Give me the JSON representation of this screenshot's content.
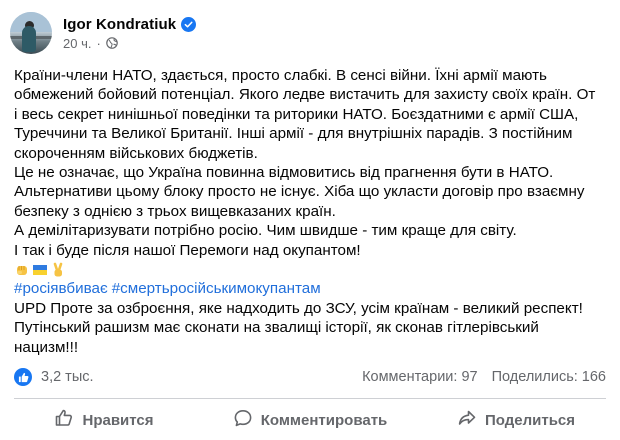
{
  "author": {
    "name": "Igor Kondratiuk",
    "time": "20 ч.",
    "separator": "·",
    "verified_icon": "verified-badge-icon",
    "audience_icon": "globe-icon"
  },
  "post": {
    "lines": [
      "Країни-члени НАТО, здається,  просто слабкі. В сенсі війни. Їхні армії мають",
      "обмежений бойовий потенціал. Якого ледве вистачить для захисту своїх країн. От",
      "і весь секрет нинішньої поведінки та риторики НАТО.  Боєздатними є армії США,",
      "Туреччини та Великої Британії. Інші армії - для внутрішніх парадів. З постійним",
      "скороченням військових бюджетів.",
      "Це не означає, що Україна повинна відмовитись від прагнення бути в НАТО.",
      "Альтернативи цьому блоку просто не існує. Хіба що укласти договір про взаємну",
      "безпеку з однією з трьох вищевказаних країн.",
      "А демілітаризувати потрібно росію. Чим швидше - тим краще для світу.",
      "І так і буде після нашої Перемоги над окупантом!"
    ],
    "emojis": [
      "raised-fist-icon",
      "ukraine-flag-icon",
      "victory-hand-icon"
    ],
    "hashtags": [
      "#росіявбиває",
      "#смертьросійськимокупантам"
    ],
    "update_lines": [
      "UPD Проте за озброєння, яке надходить до ЗСУ, усім країнам - великий респект!",
      "Путінський рашизм має сконати на звалищі історії, як сконав гітлерівський",
      "нацизм!!!"
    ]
  },
  "stats": {
    "reactions": "3,2 тыс.",
    "comments": "Комментарии: 97",
    "shares": "Поделились: 166"
  },
  "actions": {
    "like": "Нравится",
    "comment": "Комментировать",
    "share": "Поделиться"
  },
  "colors": {
    "accent": "#1877f2",
    "hashtag": "#216fdb",
    "secondary_text": "#65676b"
  }
}
